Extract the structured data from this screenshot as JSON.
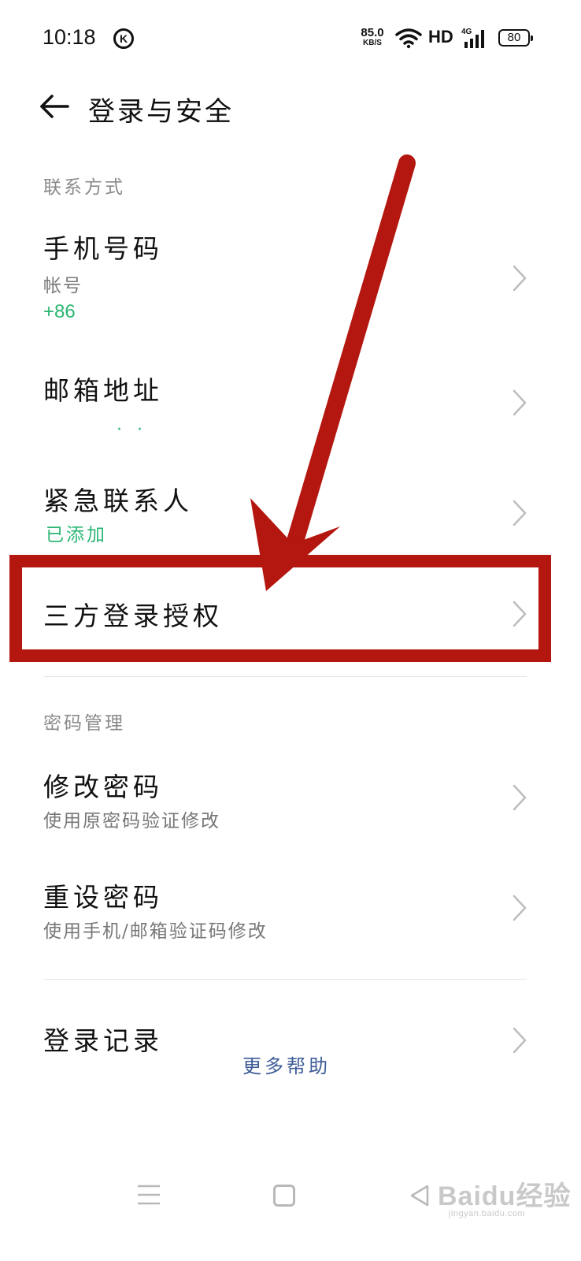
{
  "status_bar": {
    "time": "10:18",
    "k_label": "K",
    "net_speed_value": "85.0",
    "net_speed_unit": "KB/S",
    "hd_label": "HD",
    "network_type": "4G",
    "battery_level": "80",
    "icons": [
      "k-icon",
      "wifi-icon",
      "signal-icon",
      "battery-icon"
    ]
  },
  "header": {
    "back_icon": "back-arrow-icon",
    "title": "登录与安全"
  },
  "sections": {
    "contact": {
      "label": "联系方式",
      "phone": {
        "title": "手机号码",
        "subtitle": "帐号",
        "value": "+86"
      },
      "email": {
        "title": "邮箱地址",
        "value": "· ·"
      },
      "emergency": {
        "title": "紧急联系人",
        "status": "已添加"
      },
      "third_party": {
        "title": "三方登录授权"
      }
    },
    "password": {
      "label": "密码管理",
      "change": {
        "title": "修改密码",
        "subtitle": "使用原密码验证修改"
      },
      "reset": {
        "title": "重设密码",
        "subtitle": "使用手机/邮箱验证码修改"
      }
    },
    "misc": {
      "login_records": {
        "title": "登录记录"
      },
      "more_help": "更多帮助"
    }
  },
  "annotation": {
    "color": "#b3170f"
  },
  "nav_bar": {
    "icons": [
      "menu-icon",
      "home-icon",
      "back-triangle-icon"
    ]
  },
  "watermark": {
    "brand": "Baidu经验",
    "url": "jingyan.baidu.com"
  },
  "colors": {
    "accent_green": "#2bb673",
    "link_blue": "#3e5c97",
    "annotation_red": "#b3170f"
  }
}
